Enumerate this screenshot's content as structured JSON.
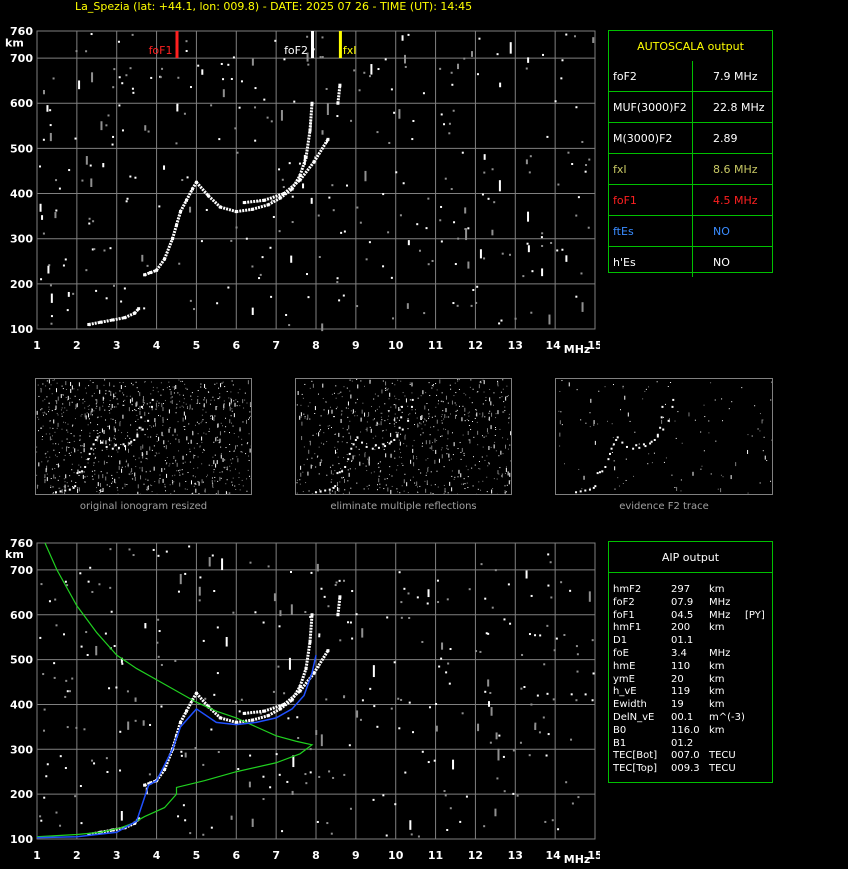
{
  "header": {
    "title": "La_Spezia (lat: +44.1, lon: 009.8) - DATE: 2025 07 26 - TIME (UT): 14:45"
  },
  "colors": {
    "background": "#000000",
    "grid": "#808080",
    "accent_green": "#00c000",
    "yellow": "#ffff00",
    "red": "#ff2020",
    "blue": "#3a6bff",
    "olive": "#c8c864",
    "trace": "#ffffff",
    "aip_blue": "#2050ff",
    "aip_green": "#20d020"
  },
  "autoscala": {
    "title": "AUTOSCALA output",
    "rows": [
      {
        "label": "foF2",
        "value": "7.9 MHz",
        "color": "#ffffff"
      },
      {
        "label": "MUF(3000)F2",
        "value": "22.8 MHz",
        "color": "#ffffff"
      },
      {
        "label": "M(3000)F2",
        "value": "2.89",
        "color": "#ffffff"
      },
      {
        "label": "fxI",
        "value": "8.6 MHz",
        "color": "#c8c864"
      },
      {
        "label": "foF1",
        "value": "4.5 MHz",
        "color": "#ff2020"
      },
      {
        "label": "ftEs",
        "value": "NO",
        "color": "#3a8cff"
      },
      {
        "label": "h'Es",
        "value": "NO",
        "color": "#ffffff"
      }
    ]
  },
  "aip": {
    "title": "AIP output",
    "rows": [
      [
        "hmF2",
        "297",
        "km",
        ""
      ],
      [
        "foF2",
        "07.9",
        "MHz",
        ""
      ],
      [
        "foF1",
        "04.5",
        "MHz",
        "[PY]"
      ],
      [
        "hmF1",
        "200",
        "km",
        ""
      ],
      [
        "D1",
        "01.1",
        "",
        ""
      ],
      [
        "foE",
        "3.4",
        "MHz",
        ""
      ],
      [
        "hmE",
        "110",
        "km",
        ""
      ],
      [
        "ymE",
        "20",
        "km",
        ""
      ],
      [
        "h_vE",
        "119",
        "km",
        ""
      ],
      [
        "Ewidth",
        "19",
        "km",
        ""
      ],
      [
        "DelN_vE",
        "00.1",
        "m^(-3)",
        ""
      ],
      [
        "B0",
        "116.0",
        "km",
        ""
      ],
      [
        "B1",
        "01.2",
        "",
        ""
      ],
      [
        "TEC[Bot]",
        "007.0",
        "TECU",
        ""
      ],
      [
        "TEC[Top]",
        "009.3",
        "TECU",
        ""
      ]
    ]
  },
  "captions": {
    "thumb1": "original ionogram resized",
    "thumb2": "eliminate multiple reflections",
    "thumb3": "evidence F2 trace"
  },
  "axes": {
    "y_unit": "km",
    "x_unit": "MHz",
    "x_ticks": [
      "1",
      "2",
      "3",
      "4",
      "5",
      "6",
      "7",
      "8",
      "9",
      "10",
      "11",
      "12",
      "13",
      "14",
      "15"
    ],
    "y_ticks": [
      "100",
      "200",
      "300",
      "400",
      "500",
      "600",
      "700",
      "760"
    ]
  },
  "markers": [
    {
      "label": "foF1",
      "freq": 4.5,
      "color": "#ff2020"
    },
    {
      "label": "foF2",
      "freq": 7.9,
      "color": "#ffffff"
    },
    {
      "label": "fxI",
      "freq": 8.6,
      "color": "#ffff00"
    }
  ],
  "chart_data": [
    {
      "type": "scatter",
      "title": "",
      "xlabel": "MHz",
      "ylabel": "km",
      "xlim": [
        1,
        15
      ],
      "ylim": [
        100,
        760
      ],
      "grid": true,
      "series": [
        {
          "values": [
            [
              2.3,
              110
            ],
            [
              2.6,
              115
            ],
            [
              2.9,
              120
            ],
            [
              3.2,
              125
            ],
            [
              3.45,
              135
            ],
            [
              3.55,
              145
            ],
            [
              3.7,
              220
            ],
            [
              3.85,
              225
            ],
            [
              4.0,
              230
            ],
            [
              4.2,
              255
            ],
            [
              4.4,
              300
            ],
            [
              4.5,
              330
            ],
            [
              4.6,
              360
            ],
            [
              4.75,
              385
            ],
            [
              4.9,
              410
            ],
            [
              5.0,
              425
            ],
            [
              5.3,
              395
            ],
            [
              5.6,
              370
            ],
            [
              6.0,
              360
            ],
            [
              6.4,
              365
            ],
            [
              6.8,
              375
            ],
            [
              7.1,
              390
            ],
            [
              7.4,
              410
            ],
            [
              7.6,
              440
            ],
            [
              7.75,
              480
            ],
            [
              7.85,
              540
            ],
            [
              7.9,
              600
            ],
            [
              6.2,
              380
            ],
            [
              6.7,
              385
            ],
            [
              7.2,
              400
            ],
            [
              7.6,
              430
            ],
            [
              7.95,
              470
            ],
            [
              8.3,
              520
            ],
            [
              8.55,
              600
            ],
            [
              8.6,
              640
            ]
          ]
        }
      ]
    },
    {
      "type": "line",
      "title": "",
      "xlabel": "MHz",
      "ylabel": "km",
      "xlim": [
        1,
        15
      ],
      "ylim": [
        100,
        760
      ],
      "grid": true,
      "series": [
        {
          "values": [
            [
              1.2,
              760
            ],
            [
              1.5,
              700
            ],
            [
              2.0,
              620
            ],
            [
              2.5,
              560
            ],
            [
              3.0,
              510
            ],
            [
              3.5,
              480
            ],
            [
              4.0,
              455
            ],
            [
              4.5,
              430
            ],
            [
              5.0,
              405
            ],
            [
              5.5,
              385
            ],
            [
              6.0,
              370
            ],
            [
              6.5,
              350
            ],
            [
              7.0,
              330
            ],
            [
              7.5,
              318
            ],
            [
              7.9,
              310
            ],
            [
              7.6,
              290
            ],
            [
              7.0,
              270
            ],
            [
              6.0,
              250
            ],
            [
              5.2,
              230
            ],
            [
              4.5,
              215
            ],
            [
              4.5,
              200
            ],
            [
              4.2,
              170
            ],
            [
              3.7,
              150
            ],
            [
              3.4,
              135
            ],
            [
              3.1,
              125
            ],
            [
              2.6,
              115
            ],
            [
              2.0,
              110
            ],
            [
              1.0,
              105
            ]
          ]
        },
        {
          "values": [
            [
              1.0,
              103
            ],
            [
              2.0,
              105
            ],
            [
              3.0,
              115
            ],
            [
              3.5,
              140
            ],
            [
              3.8,
              220
            ],
            [
              4.0,
              230
            ],
            [
              4.4,
              300
            ],
            [
              4.6,
              350
            ],
            [
              5.0,
              390
            ],
            [
              5.5,
              360
            ],
            [
              6.0,
              355
            ],
            [
              6.5,
              360
            ],
            [
              7.0,
              370
            ],
            [
              7.4,
              390
            ],
            [
              7.7,
              420
            ],
            [
              7.9,
              470
            ],
            [
              8.0,
              510
            ]
          ]
        }
      ]
    }
  ]
}
